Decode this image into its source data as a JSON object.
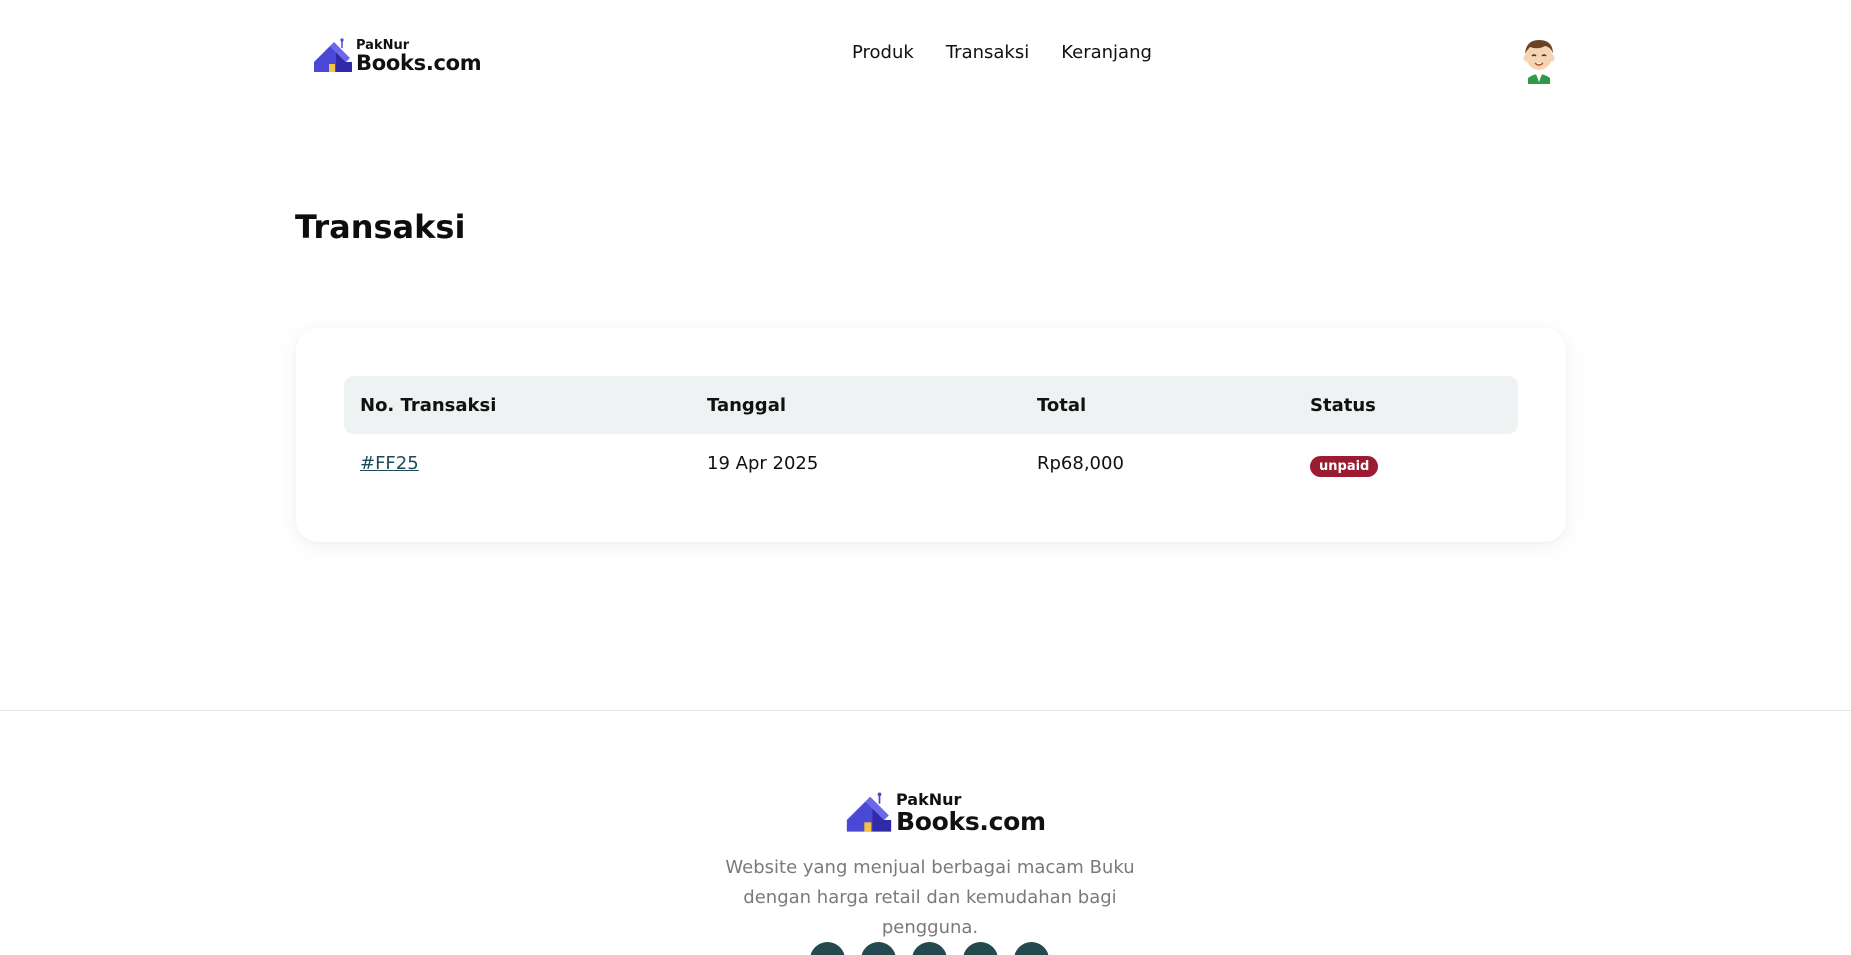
{
  "brand": {
    "small": "PakNur",
    "big": "Books.com",
    "colors": {
      "roof": "#4b48d6",
      "roof_dark": "#2f2aa8",
      "door": "#f5c344"
    }
  },
  "nav": {
    "items": [
      {
        "label": "Produk"
      },
      {
        "label": "Transaksi"
      },
      {
        "label": "Keranjang"
      }
    ]
  },
  "page": {
    "title": "Transaksi"
  },
  "table": {
    "headers": [
      "No. Transaksi",
      "Tanggal",
      "Total",
      "Status"
    ],
    "rows": [
      {
        "id": "#FF25",
        "date": "19 Apr 2025",
        "total": "Rp68,000",
        "status": "unpaid"
      }
    ],
    "status_color": "#9b1c31"
  },
  "footer": {
    "description": "Website yang menjual berbagai macam Buku dengan harga retail dan kemudahan bagi pengguna.",
    "socials": [
      "facebook-icon",
      "twitter-icon",
      "instagram-icon",
      "linkedin-icon",
      "youtube-icon"
    ],
    "social_color": "#244a4f"
  }
}
